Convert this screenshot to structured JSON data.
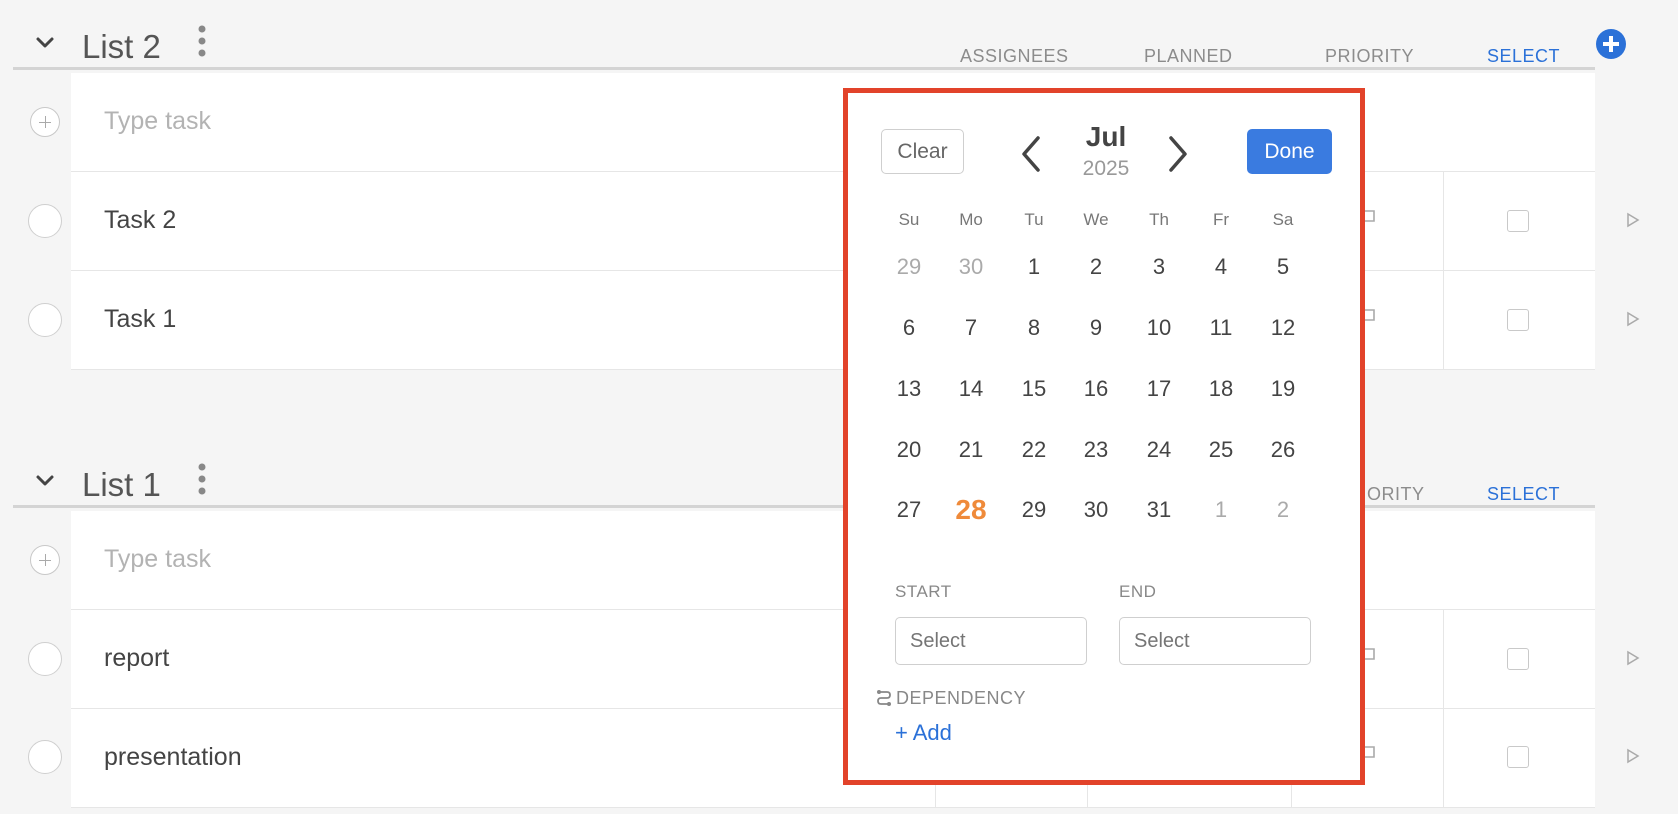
{
  "lists": [
    {
      "title": "List 2",
      "columns": [
        "ASSIGNEES",
        "PLANNED",
        "PRIORITY",
        "SELECT"
      ],
      "new_task_placeholder": "Type task",
      "tasks": [
        "Task 2",
        "Task 1"
      ]
    },
    {
      "title": "List 1",
      "columns": [
        "RIORITY",
        "SELECT"
      ],
      "new_task_placeholder": "Type task",
      "tasks": [
        "report",
        "presentation"
      ]
    }
  ],
  "date_picker": {
    "clear_label": "Clear",
    "done_label": "Done",
    "month": "Jul",
    "year": "2025",
    "weekdays": [
      "Su",
      "Mo",
      "Tu",
      "We",
      "Th",
      "Fr",
      "Sa"
    ],
    "weeks": [
      [
        "29",
        "30",
        "1",
        "2",
        "3",
        "4",
        "5"
      ],
      [
        "6",
        "7",
        "8",
        "9",
        "10",
        "11",
        "12"
      ],
      [
        "13",
        "14",
        "15",
        "16",
        "17",
        "18",
        "19"
      ],
      [
        "20",
        "21",
        "22",
        "23",
        "24",
        "25",
        "26"
      ],
      [
        "27",
        "28",
        "29",
        "30",
        "31",
        "1",
        "2"
      ]
    ],
    "today": "28",
    "start_label": "START",
    "end_label": "END",
    "start_placeholder": "Select",
    "end_placeholder": "Select",
    "dependency_label": "DEPENDENCY",
    "add_dependency_label": "+ Add"
  },
  "colors": {
    "accent": "#2b71d8",
    "popup_border": "#e2432a",
    "today": "#ef8a3a"
  }
}
